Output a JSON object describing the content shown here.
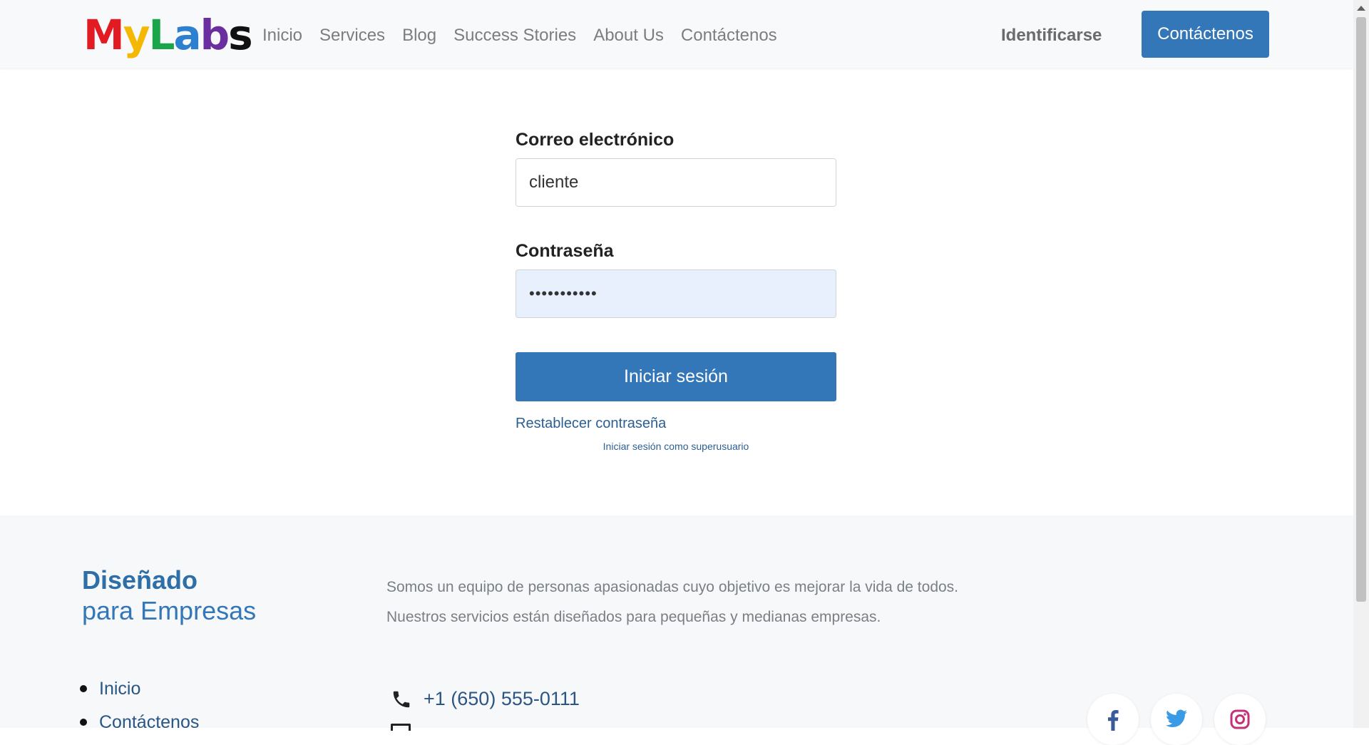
{
  "brand": {
    "logo_text": "MyLabs",
    "letters": [
      {
        "ch": "M",
        "color": "#e21b23"
      },
      {
        "ch": "y",
        "color": "#f5b800"
      },
      {
        "ch": "L",
        "color": "#1aa54a"
      },
      {
        "ch": "a",
        "color": "#2d7fcf"
      },
      {
        "ch": "b",
        "color": "#6a2e9e"
      },
      {
        "ch": "s",
        "color": "#111111"
      }
    ]
  },
  "nav": {
    "links": [
      "Inicio",
      "Services",
      "Blog",
      "Success Stories",
      "About Us",
      "Contáctenos"
    ],
    "signin": "Identificarse",
    "cta": "Contáctenos"
  },
  "login": {
    "email_label": "Correo electrónico",
    "email_value": "cliente",
    "password_label": "Contraseña",
    "password_value": "•••••••••••",
    "submit": "Iniciar sesión",
    "reset_link": "Restablecer contraseña",
    "superuser_link": "Iniciar sesión como superusuario"
  },
  "footer": {
    "tagline_1": "Diseñado",
    "tagline_2": "para Empresas",
    "about_1": "Somos un equipo de personas apasionadas cuyo objetivo es mejorar la vida de todos.",
    "about_2": "Nuestros servicios están diseñados para pequeñas y medianas empresas.",
    "links": [
      "Inicio",
      "Contáctenos"
    ],
    "phone": "+1 (650) 555-0111",
    "social_icons": [
      "facebook-icon",
      "twitter-icon",
      "instagram-icon"
    ]
  },
  "colors": {
    "primary": "#3377b8",
    "link": "#2b5f93"
  }
}
